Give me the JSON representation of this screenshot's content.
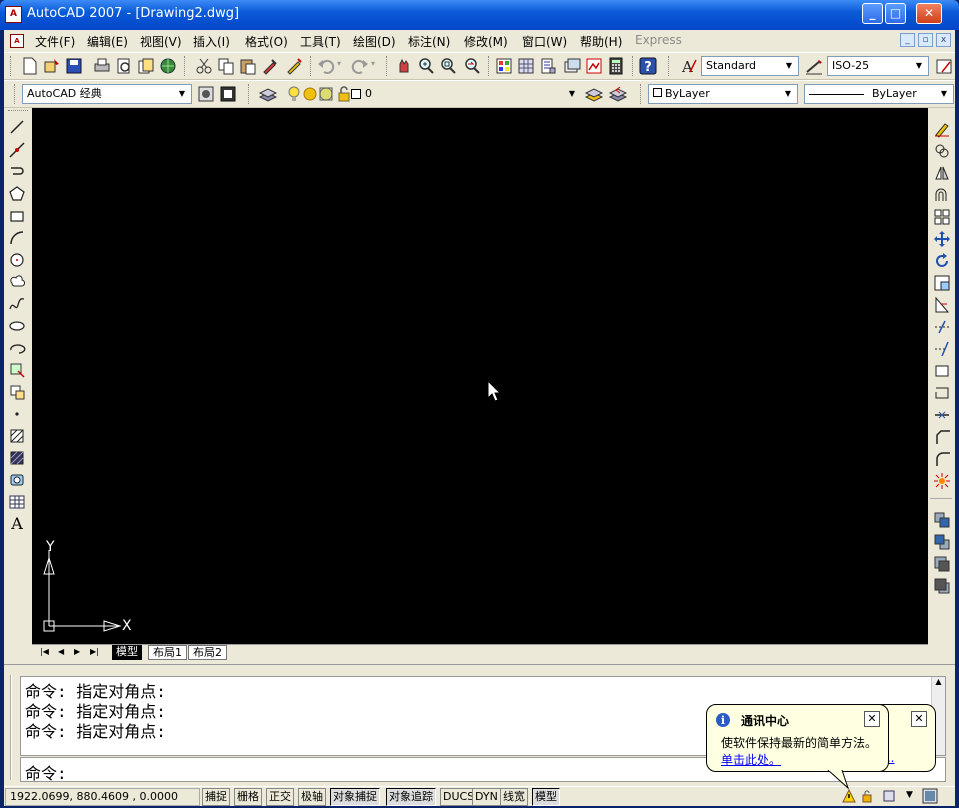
{
  "window": {
    "title": "AutoCAD 2007 - [Drawing2.dwg]",
    "app_icon": "A",
    "buttons": {
      "minimize": "_",
      "maximize": "□",
      "close": "✕"
    },
    "mdi_buttons": {
      "minimize": "_",
      "restore": "▫",
      "close": "x"
    }
  },
  "menu": [
    "文件(F)",
    "编辑(E)",
    "视图(V)",
    "插入(I)",
    "格式(O)",
    "工具(T)",
    "绘图(D)",
    "标注(N)",
    "修改(M)",
    "窗口(W)",
    "帮助(H)",
    "Express"
  ],
  "toolbar": {
    "text_style": "Standard",
    "dim_style": "ISO-25",
    "workspace": "AutoCAD 经典",
    "layer": "0",
    "color": "ByLayer",
    "linetype": "ByLayer"
  },
  "axes": {
    "x_label": "X",
    "y_label": "Y"
  },
  "tabs": {
    "model": "模型",
    "layout1": "布局1",
    "layout2": "布局2"
  },
  "command": {
    "history": [
      "命令: 指定对角点:",
      "命令: 指定对角点:",
      "命令: 指定对角点:"
    ],
    "prompt": "命令:"
  },
  "status": {
    "coords": "1922.0699, 880.4609 , 0.0000",
    "buttons": [
      "捕捉",
      "栅格",
      "正交",
      "极轴",
      "对象捕捉",
      "对象追踪",
      "DUCS",
      "DYN",
      "线宽",
      "模型"
    ]
  },
  "balloon": {
    "title": "通讯中心",
    "message": "使软件保持最新的简单方法。",
    "link": "单击此处。",
    "behind_link": "息..."
  },
  "colors": {
    "canvas": "#000000",
    "titlebar": "#0a5bd8",
    "balloon": "#ffffe1",
    "link": "#0000ff"
  }
}
